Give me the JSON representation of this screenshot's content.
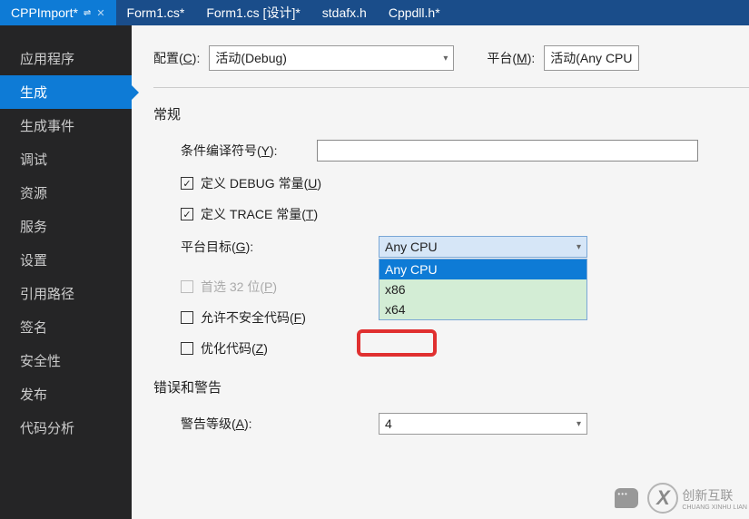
{
  "tabs": [
    {
      "label": "CPPImport*",
      "active": true,
      "pin": "⇌",
      "close": "✕"
    },
    {
      "label": "Form1.cs*"
    },
    {
      "label": "Form1.cs [设计]*"
    },
    {
      "label": "stdafx.h"
    },
    {
      "label": "Cppdll.h*"
    }
  ],
  "sidebar": {
    "items": [
      "应用程序",
      "生成",
      "生成事件",
      "调试",
      "资源",
      "服务",
      "设置",
      "引用路径",
      "签名",
      "安全性",
      "发布",
      "代码分析"
    ],
    "selected_index": 1
  },
  "panel": {
    "config_label_pre": "配置(",
    "config_hotkey": "C",
    "config_label_post": "):",
    "config_value": "活动(Debug)",
    "platform_label_pre": "平台(",
    "platform_hotkey": "M",
    "platform_label_post": "):",
    "platform_value": "活动(Any CPU",
    "section_general": "常规",
    "symbols_label_pre": "条件编译符号(",
    "symbols_hotkey": "Y",
    "symbols_label_post": "):",
    "debug_const_pre": "定义 DEBUG 常量(",
    "debug_hotkey": "U",
    "debug_const_post": ")",
    "trace_const_pre": "定义 TRACE 常量(",
    "trace_hotkey": "T",
    "trace_const_post": ")",
    "target_label_pre": "平台目标(",
    "target_hotkey": "G",
    "target_label_post": "):",
    "target_value": "Any CPU",
    "target_options": [
      "Any CPU",
      "x86",
      "x64"
    ],
    "prefer32_pre": "首选 32 位(",
    "prefer32_hotkey": "P",
    "prefer32_post": ")",
    "unsafe_pre": "允许不安全代码(",
    "unsafe_hotkey": "F",
    "unsafe_post": ")",
    "optimize_pre": "优化代码(",
    "optimize_hotkey": "Z",
    "optimize_post": ")",
    "section_errwarn": "错误和警告",
    "warn_level_pre": "警告等级(",
    "warn_level_hotkey": "A",
    "warn_level_post": "):",
    "warn_level_value": "4"
  },
  "watermark": {
    "brand": "创新互联",
    "sub": "CHUANG XINHU LIAN"
  }
}
